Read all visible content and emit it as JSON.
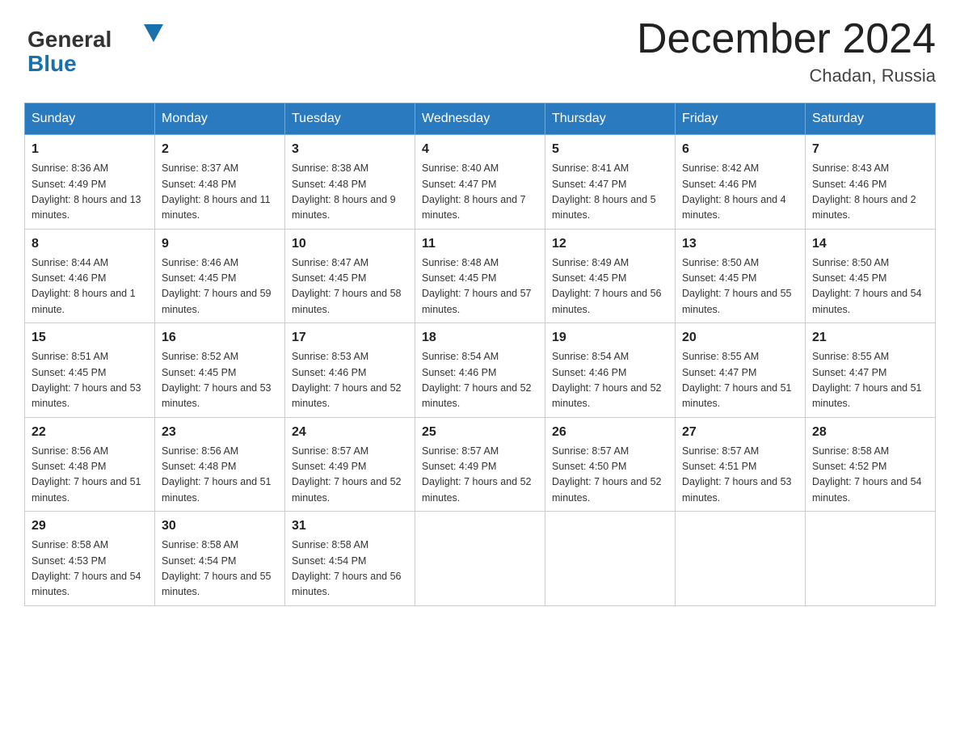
{
  "header": {
    "logo_general": "General",
    "logo_blue": "Blue",
    "month_title": "December 2024",
    "location": "Chadan, Russia"
  },
  "weekdays": [
    "Sunday",
    "Monday",
    "Tuesday",
    "Wednesday",
    "Thursday",
    "Friday",
    "Saturday"
  ],
  "weeks": [
    [
      {
        "day": "1",
        "sunrise": "Sunrise: 8:36 AM",
        "sunset": "Sunset: 4:49 PM",
        "daylight": "Daylight: 8 hours and 13 minutes."
      },
      {
        "day": "2",
        "sunrise": "Sunrise: 8:37 AM",
        "sunset": "Sunset: 4:48 PM",
        "daylight": "Daylight: 8 hours and 11 minutes."
      },
      {
        "day": "3",
        "sunrise": "Sunrise: 8:38 AM",
        "sunset": "Sunset: 4:48 PM",
        "daylight": "Daylight: 8 hours and 9 minutes."
      },
      {
        "day": "4",
        "sunrise": "Sunrise: 8:40 AM",
        "sunset": "Sunset: 4:47 PM",
        "daylight": "Daylight: 8 hours and 7 minutes."
      },
      {
        "day": "5",
        "sunrise": "Sunrise: 8:41 AM",
        "sunset": "Sunset: 4:47 PM",
        "daylight": "Daylight: 8 hours and 5 minutes."
      },
      {
        "day": "6",
        "sunrise": "Sunrise: 8:42 AM",
        "sunset": "Sunset: 4:46 PM",
        "daylight": "Daylight: 8 hours and 4 minutes."
      },
      {
        "day": "7",
        "sunrise": "Sunrise: 8:43 AM",
        "sunset": "Sunset: 4:46 PM",
        "daylight": "Daylight: 8 hours and 2 minutes."
      }
    ],
    [
      {
        "day": "8",
        "sunrise": "Sunrise: 8:44 AM",
        "sunset": "Sunset: 4:46 PM",
        "daylight": "Daylight: 8 hours and 1 minute."
      },
      {
        "day": "9",
        "sunrise": "Sunrise: 8:46 AM",
        "sunset": "Sunset: 4:45 PM",
        "daylight": "Daylight: 7 hours and 59 minutes."
      },
      {
        "day": "10",
        "sunrise": "Sunrise: 8:47 AM",
        "sunset": "Sunset: 4:45 PM",
        "daylight": "Daylight: 7 hours and 58 minutes."
      },
      {
        "day": "11",
        "sunrise": "Sunrise: 8:48 AM",
        "sunset": "Sunset: 4:45 PM",
        "daylight": "Daylight: 7 hours and 57 minutes."
      },
      {
        "day": "12",
        "sunrise": "Sunrise: 8:49 AM",
        "sunset": "Sunset: 4:45 PM",
        "daylight": "Daylight: 7 hours and 56 minutes."
      },
      {
        "day": "13",
        "sunrise": "Sunrise: 8:50 AM",
        "sunset": "Sunset: 4:45 PM",
        "daylight": "Daylight: 7 hours and 55 minutes."
      },
      {
        "day": "14",
        "sunrise": "Sunrise: 8:50 AM",
        "sunset": "Sunset: 4:45 PM",
        "daylight": "Daylight: 7 hours and 54 minutes."
      }
    ],
    [
      {
        "day": "15",
        "sunrise": "Sunrise: 8:51 AM",
        "sunset": "Sunset: 4:45 PM",
        "daylight": "Daylight: 7 hours and 53 minutes."
      },
      {
        "day": "16",
        "sunrise": "Sunrise: 8:52 AM",
        "sunset": "Sunset: 4:45 PM",
        "daylight": "Daylight: 7 hours and 53 minutes."
      },
      {
        "day": "17",
        "sunrise": "Sunrise: 8:53 AM",
        "sunset": "Sunset: 4:46 PM",
        "daylight": "Daylight: 7 hours and 52 minutes."
      },
      {
        "day": "18",
        "sunrise": "Sunrise: 8:54 AM",
        "sunset": "Sunset: 4:46 PM",
        "daylight": "Daylight: 7 hours and 52 minutes."
      },
      {
        "day": "19",
        "sunrise": "Sunrise: 8:54 AM",
        "sunset": "Sunset: 4:46 PM",
        "daylight": "Daylight: 7 hours and 52 minutes."
      },
      {
        "day": "20",
        "sunrise": "Sunrise: 8:55 AM",
        "sunset": "Sunset: 4:47 PM",
        "daylight": "Daylight: 7 hours and 51 minutes."
      },
      {
        "day": "21",
        "sunrise": "Sunrise: 8:55 AM",
        "sunset": "Sunset: 4:47 PM",
        "daylight": "Daylight: 7 hours and 51 minutes."
      }
    ],
    [
      {
        "day": "22",
        "sunrise": "Sunrise: 8:56 AM",
        "sunset": "Sunset: 4:48 PM",
        "daylight": "Daylight: 7 hours and 51 minutes."
      },
      {
        "day": "23",
        "sunrise": "Sunrise: 8:56 AM",
        "sunset": "Sunset: 4:48 PM",
        "daylight": "Daylight: 7 hours and 51 minutes."
      },
      {
        "day": "24",
        "sunrise": "Sunrise: 8:57 AM",
        "sunset": "Sunset: 4:49 PM",
        "daylight": "Daylight: 7 hours and 52 minutes."
      },
      {
        "day": "25",
        "sunrise": "Sunrise: 8:57 AM",
        "sunset": "Sunset: 4:49 PM",
        "daylight": "Daylight: 7 hours and 52 minutes."
      },
      {
        "day": "26",
        "sunrise": "Sunrise: 8:57 AM",
        "sunset": "Sunset: 4:50 PM",
        "daylight": "Daylight: 7 hours and 52 minutes."
      },
      {
        "day": "27",
        "sunrise": "Sunrise: 8:57 AM",
        "sunset": "Sunset: 4:51 PM",
        "daylight": "Daylight: 7 hours and 53 minutes."
      },
      {
        "day": "28",
        "sunrise": "Sunrise: 8:58 AM",
        "sunset": "Sunset: 4:52 PM",
        "daylight": "Daylight: 7 hours and 54 minutes."
      }
    ],
    [
      {
        "day": "29",
        "sunrise": "Sunrise: 8:58 AM",
        "sunset": "Sunset: 4:53 PM",
        "daylight": "Daylight: 7 hours and 54 minutes."
      },
      {
        "day": "30",
        "sunrise": "Sunrise: 8:58 AM",
        "sunset": "Sunset: 4:54 PM",
        "daylight": "Daylight: 7 hours and 55 minutes."
      },
      {
        "day": "31",
        "sunrise": "Sunrise: 8:58 AM",
        "sunset": "Sunset: 4:54 PM",
        "daylight": "Daylight: 7 hours and 56 minutes."
      },
      null,
      null,
      null,
      null
    ]
  ]
}
